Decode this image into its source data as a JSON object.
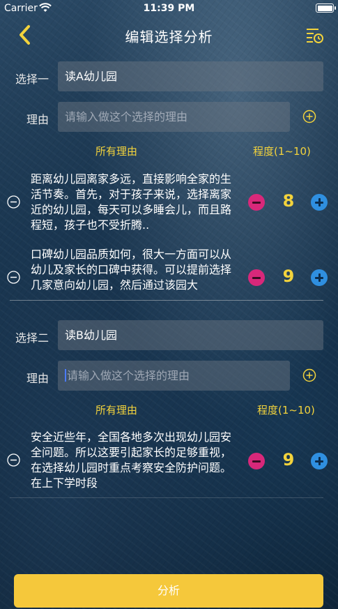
{
  "status_bar": {
    "carrier": "Carrier",
    "time": "11:39 PM"
  },
  "nav": {
    "title": "编辑选择分析"
  },
  "options": [
    {
      "choice_label": "选择一",
      "choice_value": "读A幼儿园",
      "reason_label": "理由",
      "reason_placeholder": "请输入做这个选择的理由",
      "col_reasons": "所有理由",
      "col_degree": "程度(1~10)",
      "reasons": [
        {
          "text": "距离幼儿园离家多远，直接影响全家的生活节奏。首先，对于孩子来说，选择离家近的幼儿园，每天可以多睡会儿，而且路程短，孩子也不受折腾..",
          "score": "8"
        },
        {
          "text": "口碑幼儿园品质如何，很大一方面可以从幼儿及家长的口碑中获得。可以提前选择几家意向幼儿园，然后通过该园大",
          "score": "9"
        }
      ]
    },
    {
      "choice_label": "选择二",
      "choice_value": "读B幼儿园",
      "reason_label": "理由",
      "reason_placeholder": "请输入做这个选择的理由",
      "col_reasons": "所有理由",
      "col_degree": "程度(1~10)",
      "reasons": [
        {
          "text": "安全近些年，全国各地多次出现幼儿园安全问题。所以这要引起家长的足够重视，在选择幼儿园时重点考察安全防护问题。在上下学时段",
          "score": "9"
        }
      ]
    }
  ],
  "footer": {
    "analyze_label": "分析"
  },
  "colors": {
    "accent": "#f3d33c",
    "button": "#f5c83b",
    "decrement": "#d8287a",
    "increment": "#2f8fe0"
  }
}
